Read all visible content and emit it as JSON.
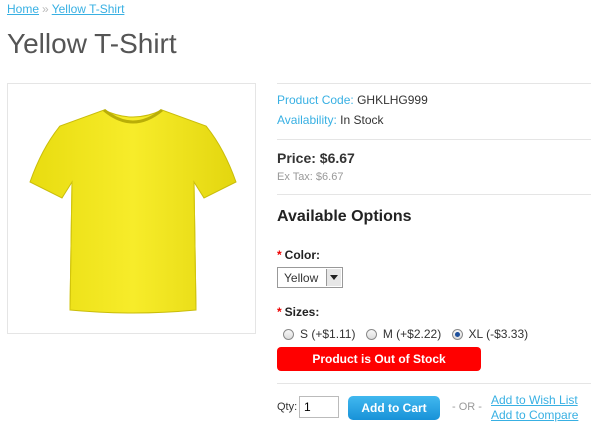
{
  "breadcrumb": {
    "home": "Home",
    "separator": "»",
    "current": "Yellow T-Shirt"
  },
  "product": {
    "title": "Yellow T-Shirt",
    "image_icon": "yellow-tshirt",
    "code_label": "Product Code:",
    "code_value": "GHKLHG999",
    "availability_label": "Availability:",
    "availability_value": "In Stock",
    "price": "Price: $6.67",
    "ex_tax": "Ex Tax: $6.67"
  },
  "options": {
    "heading": "Available Options",
    "required_mark": "*",
    "color_label": "Color:",
    "color_selected": "Yellow",
    "sizes_label": "Sizes:",
    "sizes": [
      {
        "label": "S (+$1.11)",
        "selected": false
      },
      {
        "label": "M (+$2.22)",
        "selected": false
      },
      {
        "label": "XL (-$3.33)",
        "selected": true
      }
    ],
    "stock_message": "Product is Out of Stock"
  },
  "cart": {
    "qty_label": "Qty:",
    "qty_value": "1",
    "add_button": "Add to Cart",
    "or_text": "- OR -",
    "wishlist": "Add to Wish List",
    "compare": "Add to Compare"
  },
  "colors": {
    "accent": "#38b0e3",
    "out_of_stock": "#ff0000",
    "button": "#1892d8",
    "shirt": "#f2e51b"
  }
}
